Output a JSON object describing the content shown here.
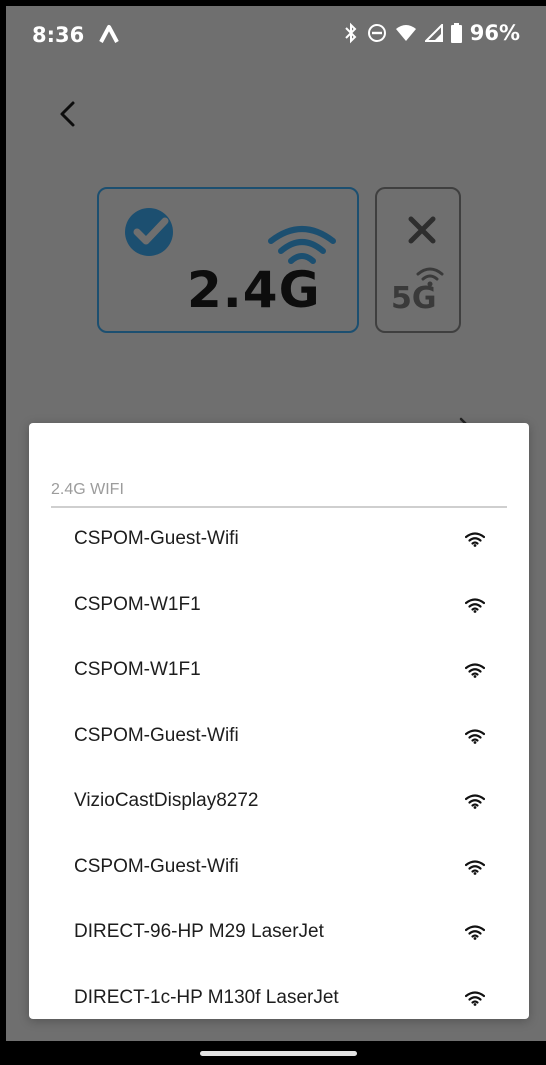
{
  "status_bar": {
    "time": "8:36",
    "battery": "96%"
  },
  "icons": {
    "back": "back-arrow-icon",
    "check": "check-circle-icon",
    "wifi": "wifi-icon",
    "x": "close-icon"
  },
  "bands": {
    "band_24_label": "2.4G",
    "band_5_label": "5G"
  },
  "sheet": {
    "section_header": "2.4G WIFI",
    "networks": [
      "CSPOM-Guest-Wifi",
      "CSPOM-W1F1",
      "CSPOM-W1F1",
      "CSPOM-Guest-Wifi",
      "VizioCastDisplay8272",
      "CSPOM-Guest-Wifi",
      "DIRECT-96-HP M29 LaserJet",
      "DIRECT-1c-HP M130f LaserJet"
    ]
  },
  "colors": {
    "dim_background": "#6f6f6f",
    "accent_blue": "#1c4f70",
    "sheet_background": "#ffffff"
  }
}
